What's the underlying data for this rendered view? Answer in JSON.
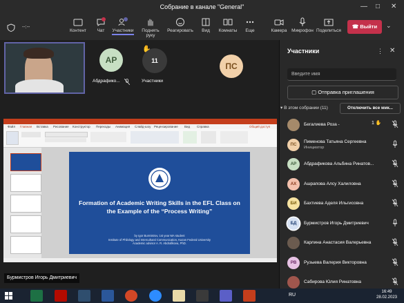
{
  "window": {
    "title": "Собрание в канале \"General\"",
    "timer": "--:--"
  },
  "toolbar": {
    "items": [
      {
        "label": "Контент"
      },
      {
        "label": "Чат",
        "badge": "1"
      },
      {
        "label": "Участники",
        "badge": "11"
      },
      {
        "label": "Поднять руку"
      },
      {
        "label": "Реагировать"
      },
      {
        "label": "Вид"
      },
      {
        "label": "Комнаты"
      },
      {
        "label": "Еще"
      },
      {
        "label": "Камера"
      },
      {
        "label": "Микрофон"
      },
      {
        "label": "Поделиться"
      }
    ],
    "leave_label": "Выйти"
  },
  "stage": {
    "tiles": [
      {
        "initials": "АР",
        "name": "Абдрафико...",
        "color": "#c7dfc3",
        "textColor": "#3e5b3b"
      },
      {
        "count": "11",
        "name": "Участники"
      },
      {
        "initials": "ПС",
        "color": "#f1d0a9",
        "textColor": "#7a4f1e"
      }
    ],
    "caption": "Бурмистров Игорь Дмитриевич",
    "slide": {
      "title": "Formation of Academic Writing Skills in the EFL Class on the Example of the “Process Writing”",
      "byline": "by Igor Burmistrov, 1st year MA student",
      "affiliation": "Institute of Philology and Intercultural Communication, Kazan Federal University",
      "advisor": "Academic advisor A. R. Abdrafikova, PhD."
    },
    "ppt_tabs": [
      "Файл",
      "Главная",
      "Вставка",
      "Рисование",
      "Конструктор",
      "Переходы",
      "Анимация",
      "Слайд-шоу",
      "Рецензирование",
      "Вид",
      "Справка"
    ],
    "ppt_side": [
      "Общий доступ"
    ]
  },
  "panel": {
    "title": "Участники",
    "search_placeholder": "Введите имя",
    "invite_label": "Отправка приглашения",
    "section_label": "В этом собрании (11)",
    "mute_all_label": "Отключить все мик...",
    "participants": [
      {
        "initials": "",
        "name": "Бегалиева Роза -",
        "color": "#a58a6a",
        "textColor": "#fff",
        "hand": "1",
        "muted": true,
        "photo": true
      },
      {
        "initials": "ПС",
        "name": "Пименова Татьяна Сергеевна",
        "sub": "Инициатор",
        "color": "#f1d0a9",
        "textColor": "#7a4f1e",
        "muted": false
      },
      {
        "initials": "АР",
        "name": "Абдрафикова Альбина Ринатов...",
        "color": "#c7dfc3",
        "textColor": "#3e5b3b",
        "muted": true
      },
      {
        "initials": "АХ",
        "name": "Ашрапова Алсу Халиловна",
        "color": "#f4c1ad",
        "textColor": "#8a3b1d",
        "muted": true
      },
      {
        "initials": "БИ",
        "name": "Бахтиева Аделя Ильгисовна",
        "color": "#f7e3a1",
        "textColor": "#7a5c0a",
        "muted": true
      },
      {
        "initials": "БД",
        "name": "Бурмистров Игорь Дмитриевич",
        "color": "#d7e2f3",
        "textColor": "#1f3f72",
        "muted": false,
        "ring": true
      },
      {
        "initials": "",
        "name": "Карлина Анастасия Валерьевна",
        "color": "#6b5b4f",
        "textColor": "#fff",
        "muted": true,
        "photo": true
      },
      {
        "initials": "РВ",
        "name": "Рузыева Валерия Викторовна",
        "color": "#e7c1e4",
        "textColor": "#6b2a66",
        "muted": true
      },
      {
        "initials": "",
        "name": "Сабирова Юлия Ринатовна",
        "color": "#a0564d",
        "textColor": "#fff",
        "muted": true,
        "photo": true
      }
    ]
  },
  "taskbar": {
    "lang": "RU",
    "time": "16:49",
    "date": "28.02.2023"
  }
}
